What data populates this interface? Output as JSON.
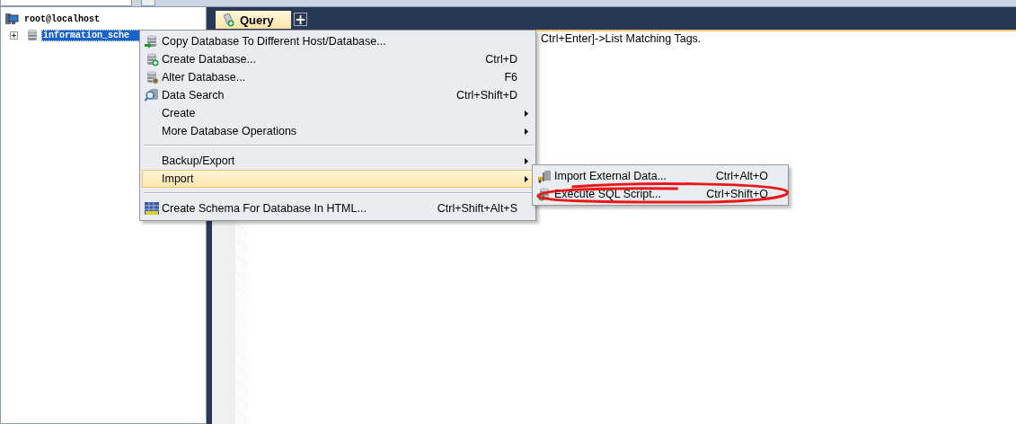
{
  "connection_tree": [
    {
      "label": "root@localhost",
      "kind": "server",
      "children": [
        {
          "label": "information_sche",
          "kind": "database",
          "selected": true,
          "expanded": false
        }
      ]
    }
  ],
  "query_tabs": [
    {
      "label": "Query",
      "selected": true
    }
  ],
  "new_tab_button": "+",
  "editor_hint": "Ctrl+Enter]->List Matching Tags.",
  "context_menu": {
    "items": [
      {
        "kind": "item",
        "label": "Copy Database To Different Host/Database...",
        "submenu": false,
        "selected": false
      },
      {
        "kind": "item",
        "label": "Create Database...",
        "shortcut": "Ctrl+D",
        "submenu": false,
        "selected": false
      },
      {
        "kind": "item",
        "label": "Alter Database...",
        "shortcut": "F6",
        "submenu": false,
        "selected": false
      },
      {
        "kind": "item",
        "label": "Data Search",
        "shortcut": "Ctrl+Shift+D",
        "submenu": false,
        "selected": false
      },
      {
        "kind": "item",
        "label": "Create",
        "submenu": true,
        "selected": false
      },
      {
        "kind": "item",
        "label": "More Database Operations",
        "submenu": true,
        "selected": false
      },
      {
        "kind": "separator"
      },
      {
        "kind": "item",
        "label": "Backup/Export",
        "submenu": true,
        "selected": false
      },
      {
        "kind": "item",
        "label": "Import",
        "submenu": true,
        "selected": true
      },
      {
        "kind": "separator"
      },
      {
        "kind": "item",
        "label": "Create Schema For Database In HTML...",
        "shortcut": "Ctrl+Shift+Alt+S",
        "submenu": false,
        "selected": false
      }
    ]
  },
  "import_submenu": {
    "items": [
      {
        "label": "Import External Data...",
        "shortcut": "Ctrl+Alt+O",
        "circled": false
      },
      {
        "label": "Execute SQL Script...",
        "shortcut": "Ctrl+Shift+Q",
        "circled": true
      }
    ]
  }
}
